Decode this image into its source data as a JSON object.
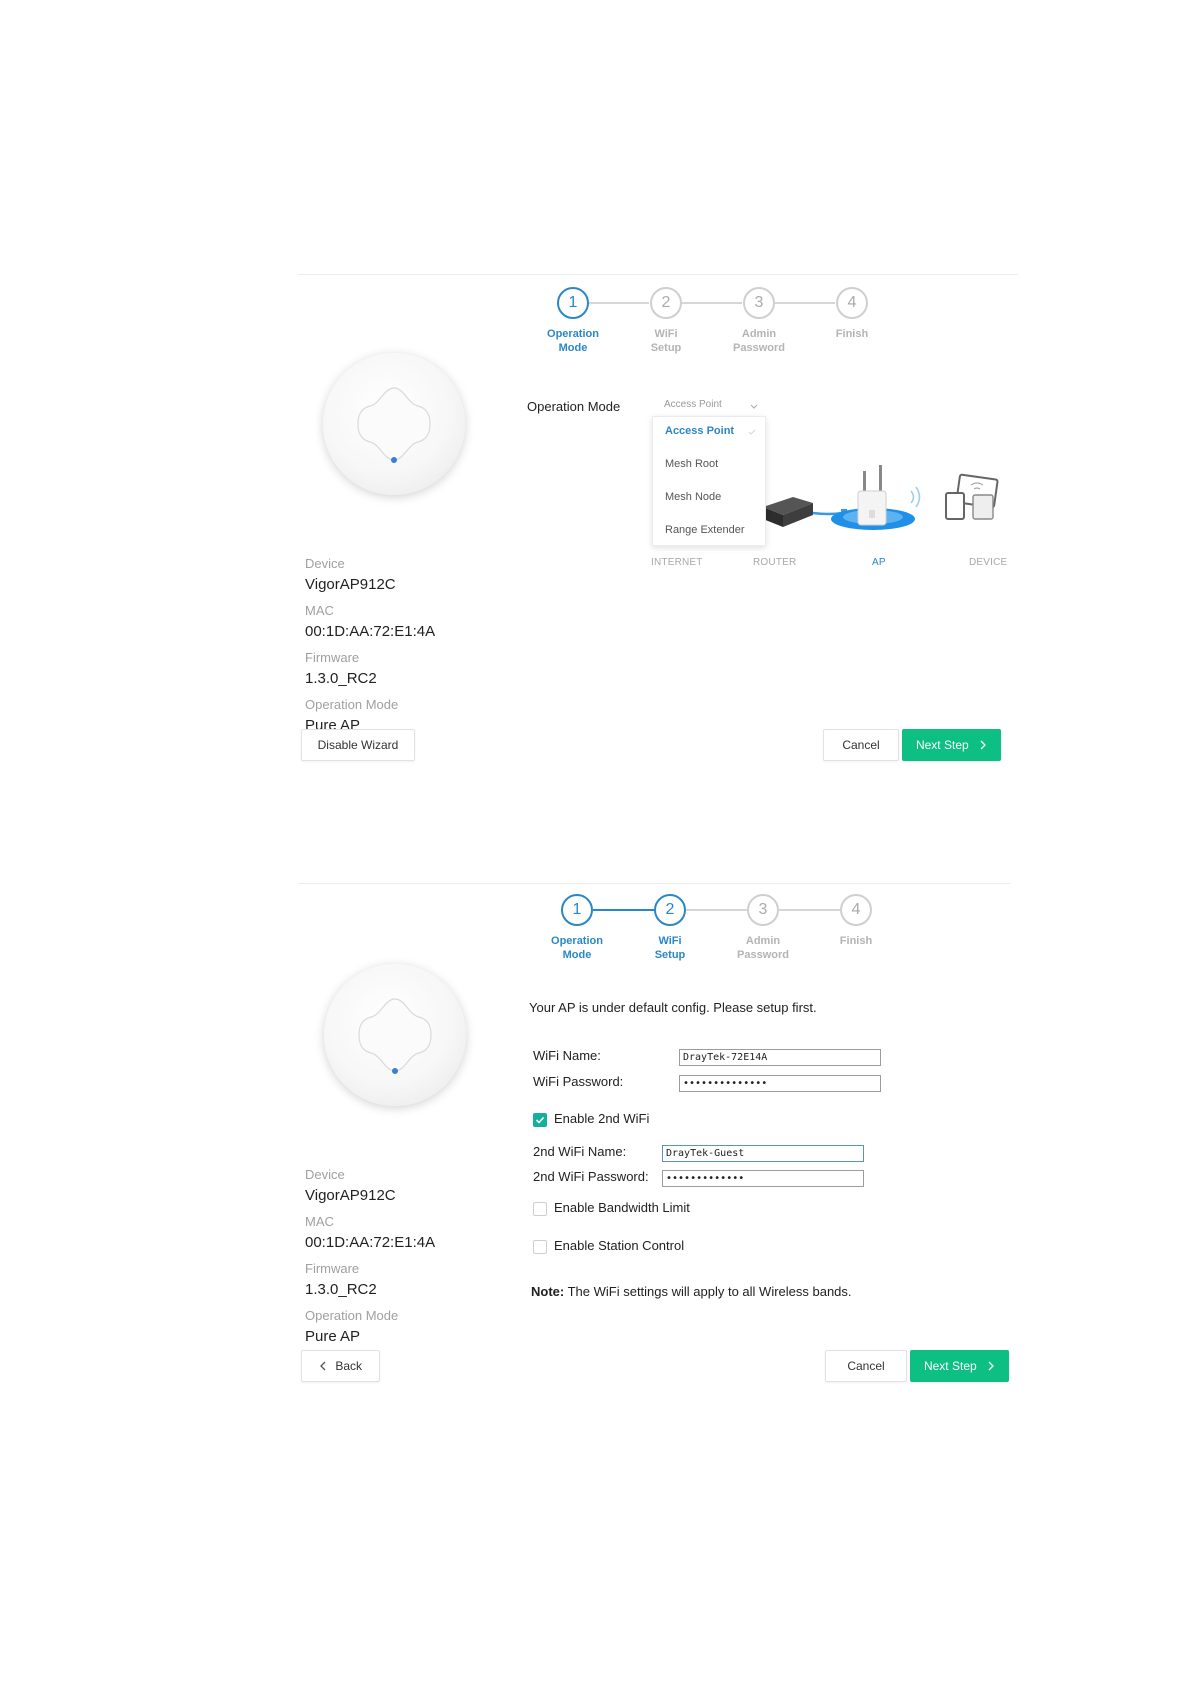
{
  "steps": [
    {
      "num": "1",
      "line1": "Operation",
      "line2": "Mode"
    },
    {
      "num": "2",
      "line1": "WiFi",
      "line2": "Setup"
    },
    {
      "num": "3",
      "line1": "Admin",
      "line2": "Password"
    },
    {
      "num": "4",
      "line1": "Finish",
      "line2": ""
    }
  ],
  "device_info": {
    "device_label": "Device",
    "device_value": "VigorAP912C",
    "mac_label": "MAC",
    "mac_value": "00:1D:AA:72:E1:4A",
    "firmware_label": "Firmware",
    "firmware_value": "1.3.0_RC2",
    "opmode_label": "Operation Mode",
    "opmode_value": "Pure AP"
  },
  "panel1": {
    "active_step": 1,
    "operation_mode_label": "Operation Mode",
    "select_value": "Access Point",
    "options": [
      "Access Point",
      "Mesh Root",
      "Mesh Node",
      "Range Extender"
    ],
    "selected_option": "Access Point",
    "diagram_labels": {
      "internet": "INTERNET",
      "router": "ROUTER",
      "ap": "AP",
      "device": "DEVICE"
    },
    "left_button": "Disable Wizard",
    "cancel_button": "Cancel",
    "next_button": "Next Step"
  },
  "panel2": {
    "active_step": 2,
    "intro": "Your AP is under default config. Please setup first.",
    "wifi_name_label": "WiFi Name:",
    "wifi_name_value": "DrayTek-72E14A",
    "wifi_password_label": "WiFi Password:",
    "wifi_password_value": "••••••••••••••",
    "enable_2nd_label": "Enable 2nd WiFi",
    "enable_2nd_checked": true,
    "wifi2_name_label": "2nd WiFi Name:",
    "wifi2_name_value": "DrayTek-Guest",
    "wifi2_password_label": "2nd WiFi Password:",
    "wifi2_password_value": "•••••••••••••",
    "bandwidth_label": "Enable Bandwidth Limit",
    "bandwidth_checked": false,
    "station_label": "Enable Station Control",
    "station_checked": false,
    "note_bold": "Note:",
    "note_text": " The WiFi settings will apply to all Wireless bands.",
    "back_button": "Back",
    "cancel_button": "Cancel",
    "next_button": "Next Step"
  },
  "colors": {
    "accent": "#2a87c8",
    "primary_button": "#0dbf82",
    "checkbox": "#13b0a0"
  }
}
